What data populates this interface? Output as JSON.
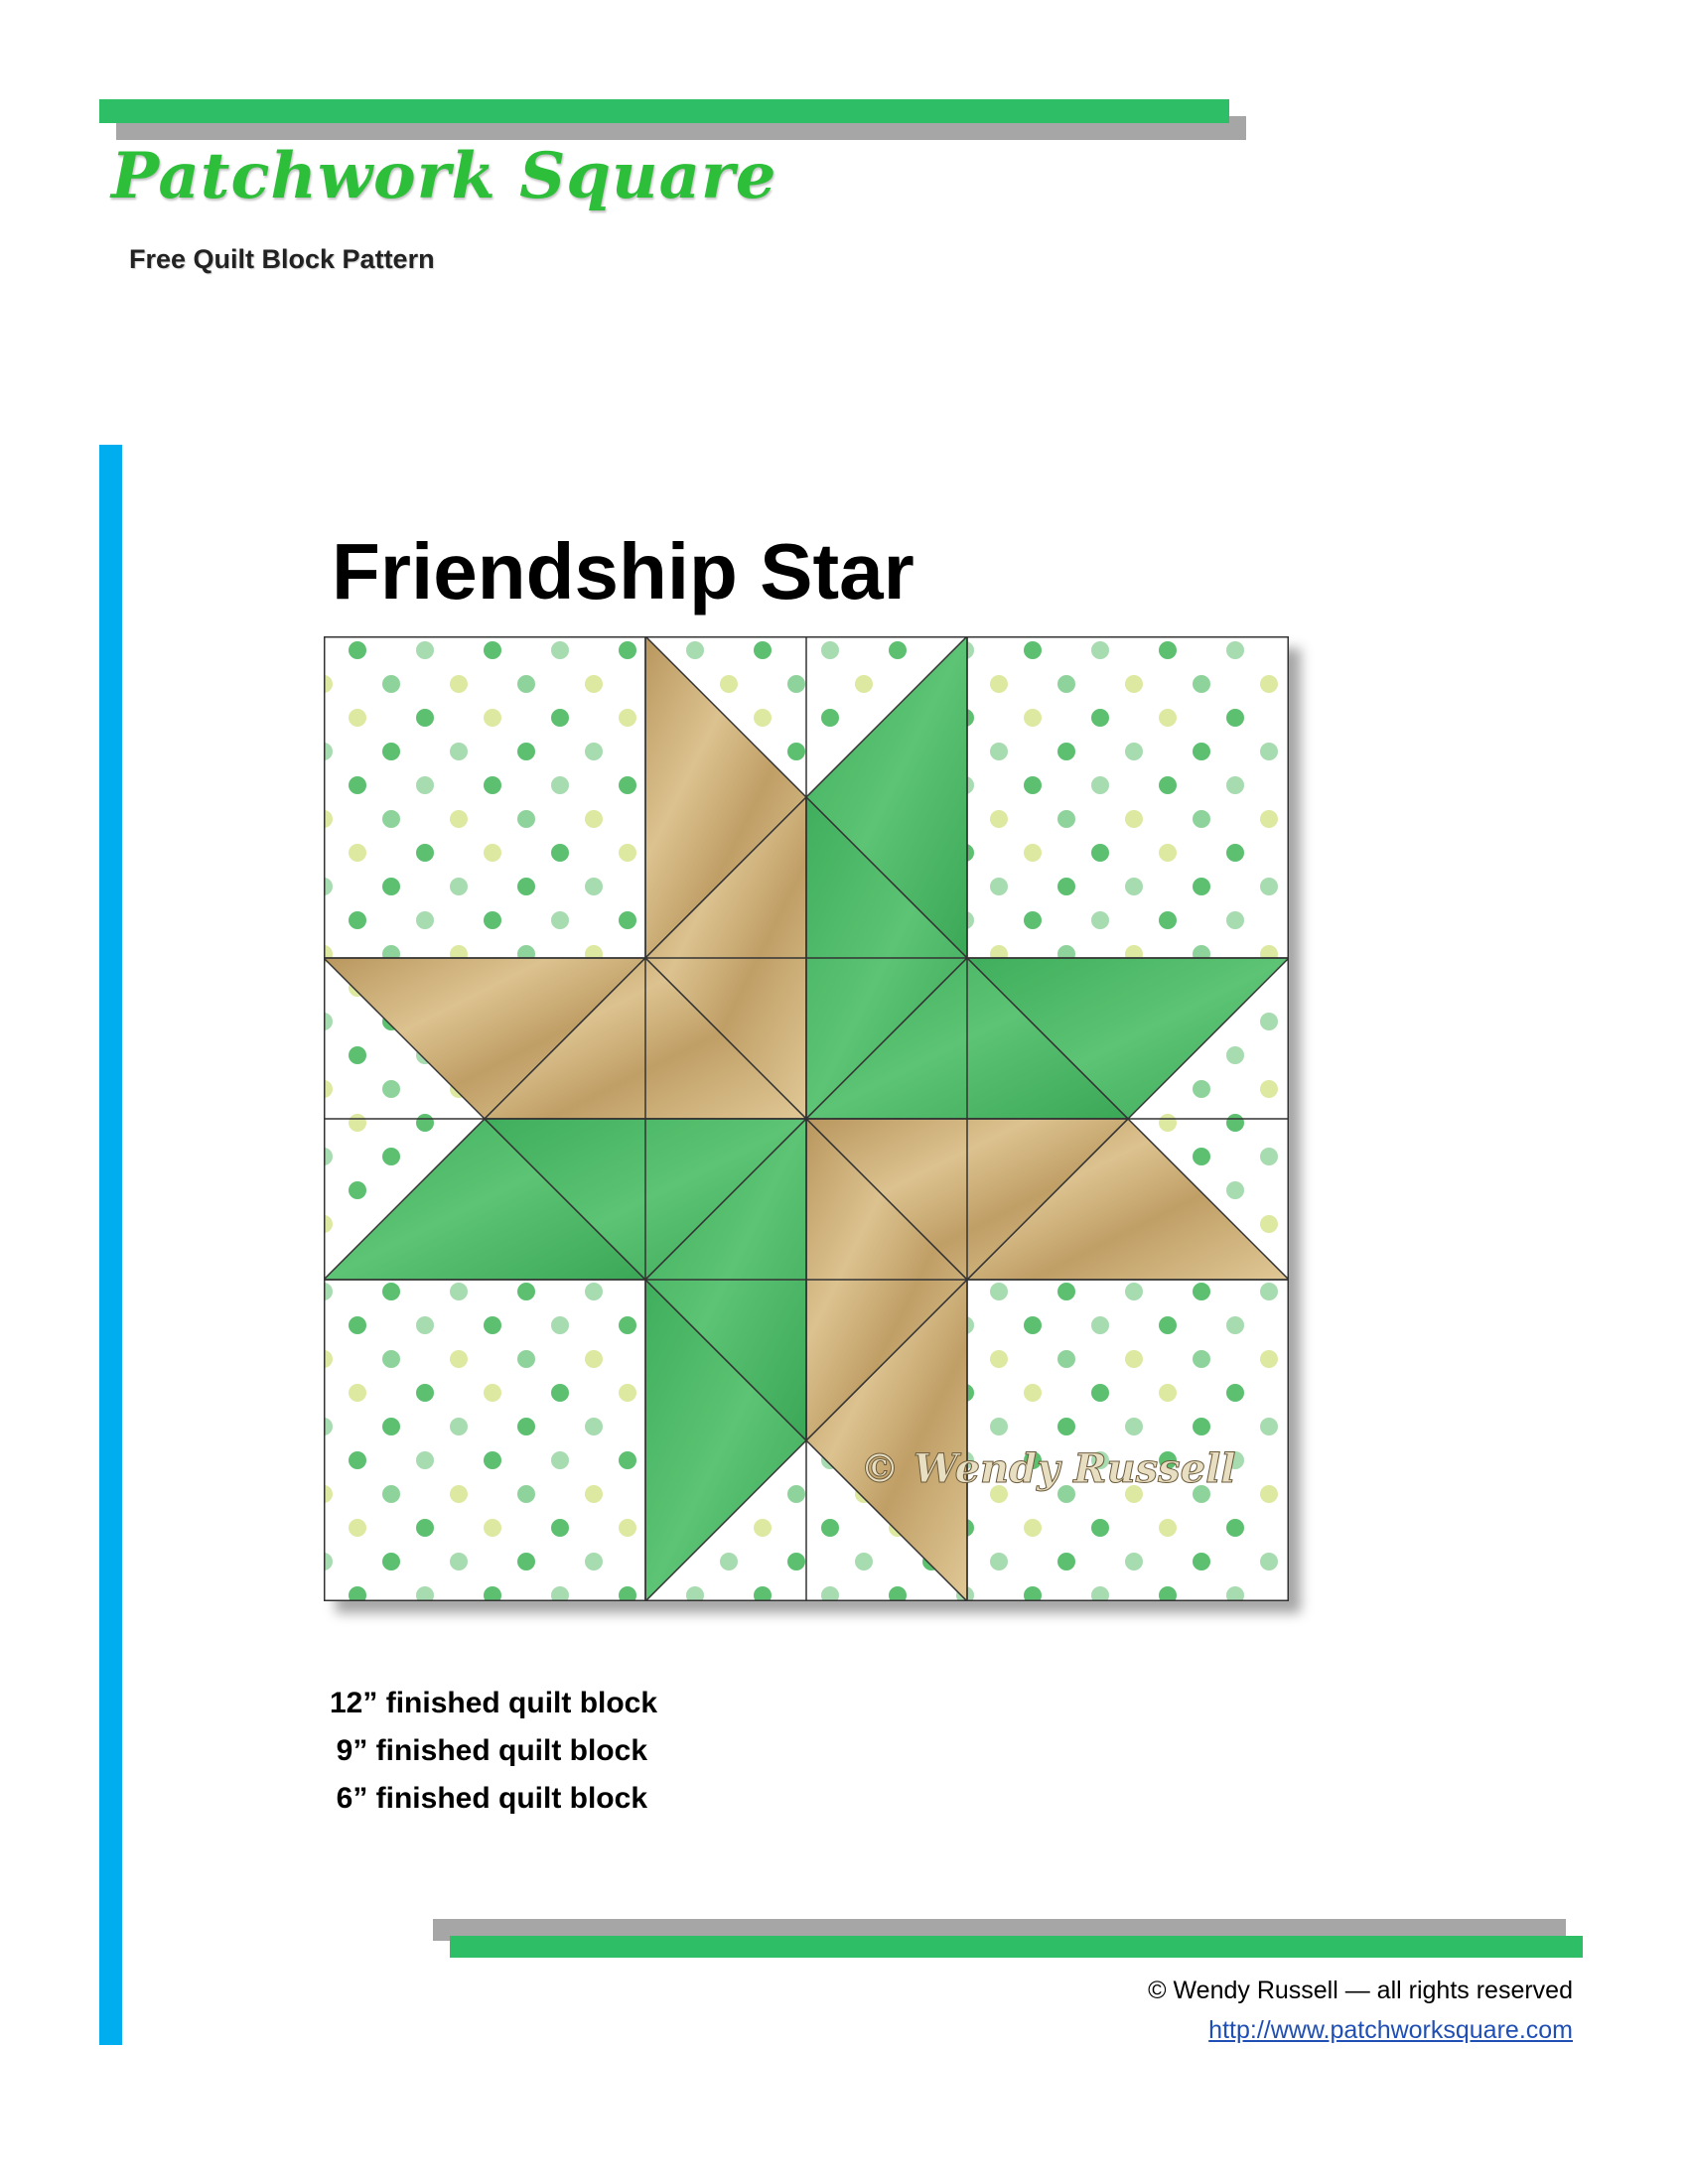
{
  "logo": {
    "title": "Patchwork Square",
    "subtitle": "Free Quilt Block Pattern"
  },
  "pattern": {
    "title": "Friendship Star",
    "watermark": "© Wendy Russell",
    "sizes": [
      "12” finished quilt block",
      "9” finished quilt block",
      "6” finished quilt block"
    ]
  },
  "footer": {
    "copyright": "© Wendy Russell — all rights reserved",
    "link": "http://www.patchworksquare.com"
  },
  "colors": {
    "green_bar": "#2ebf66",
    "gray_bar": "#a6a6a6",
    "blue_bar": "#00aeef",
    "fabric_green": "#4bb866",
    "fabric_tan": "#c4a46b",
    "dot_green": "#5cc070",
    "dot_yellow": "#dde9a0"
  }
}
